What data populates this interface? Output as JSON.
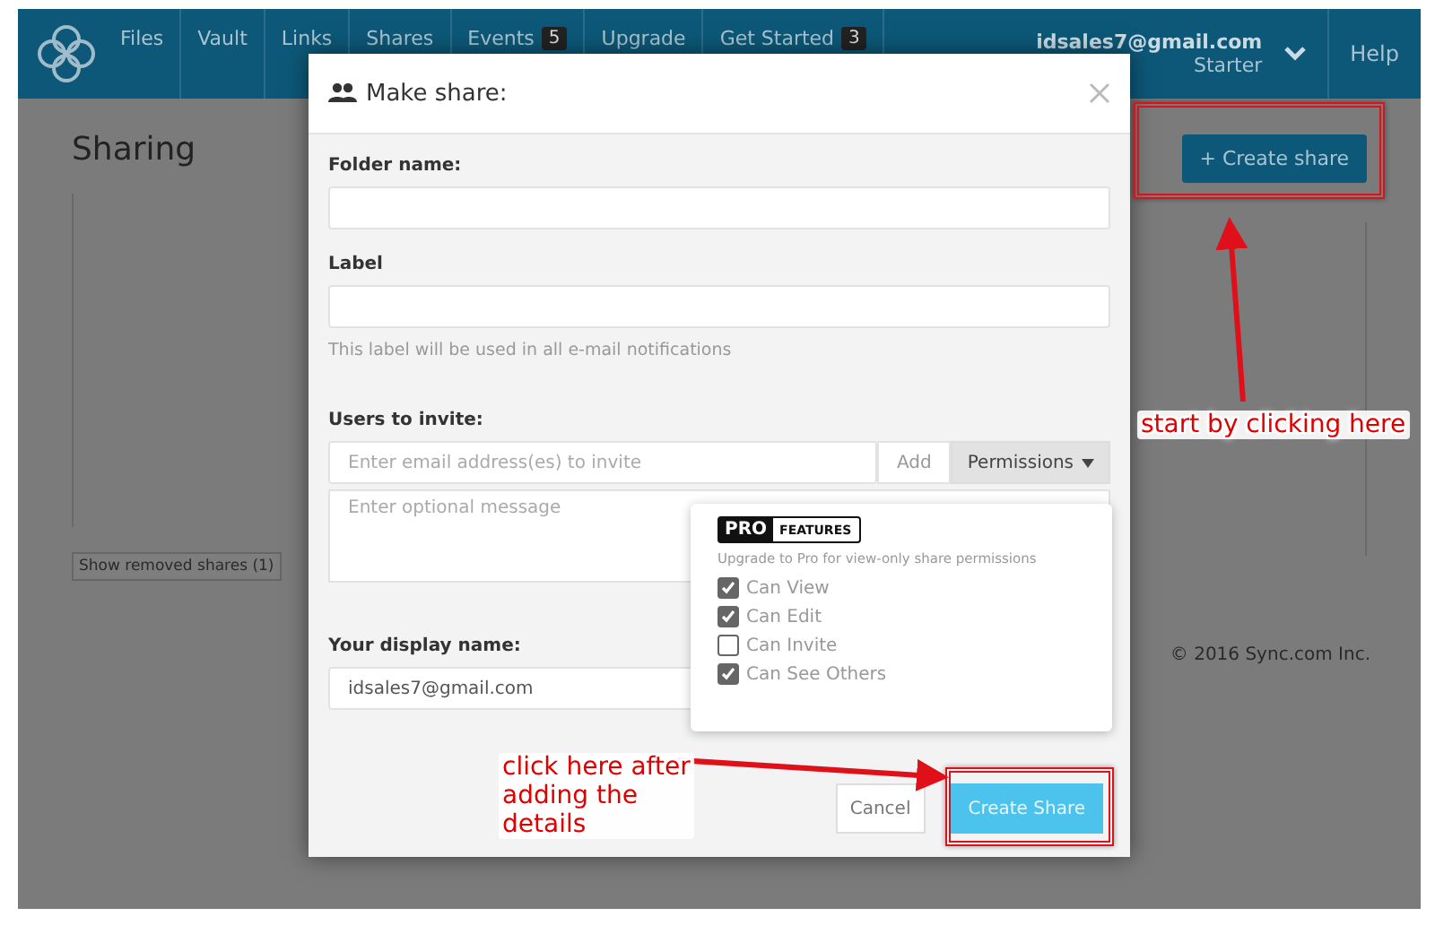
{
  "nav": {
    "items": [
      {
        "label": "Files"
      },
      {
        "label": "Vault"
      },
      {
        "label": "Links"
      },
      {
        "label": "Shares"
      },
      {
        "label": "Events",
        "badge": "5"
      },
      {
        "label": "Upgrade"
      },
      {
        "label": "Get Started",
        "badge": "3"
      }
    ],
    "account": {
      "email": "idsales7@gmail.com",
      "plan": "Starter"
    },
    "help": "Help"
  },
  "page": {
    "title": "Sharing",
    "create_button": "+ Create share",
    "removed_button": "Show removed shares (1)",
    "footer": "© 2016 Sync.com Inc."
  },
  "dialog": {
    "title": "Make share:",
    "folder_label": "Folder name:",
    "label_label": "Label",
    "label_help": "This label will be used in all e-mail notifications",
    "invite_label": "Users to invite:",
    "invite_placeholder": "Enter email address(es) to invite",
    "add_button": "Add",
    "permissions_button": "Permissions",
    "message_placeholder": "Enter optional message",
    "display_label": "Your display name:",
    "display_value": "idsales7@gmail.com",
    "cancel_button": "Cancel",
    "create_button": "Create Share"
  },
  "permissions_menu": {
    "badge_left": "PRO",
    "badge_right": "FEATURES",
    "note": "Upgrade to Pro for view-only share permissions",
    "options": [
      {
        "label": "Can View",
        "checked": true
      },
      {
        "label": "Can Edit",
        "checked": true
      },
      {
        "label": "Can Invite",
        "checked": false
      },
      {
        "label": "Can See Others",
        "checked": true
      }
    ]
  },
  "annotations": [
    {
      "text": "start by clicking here"
    },
    {
      "text": "click here after adding the details"
    }
  ]
}
